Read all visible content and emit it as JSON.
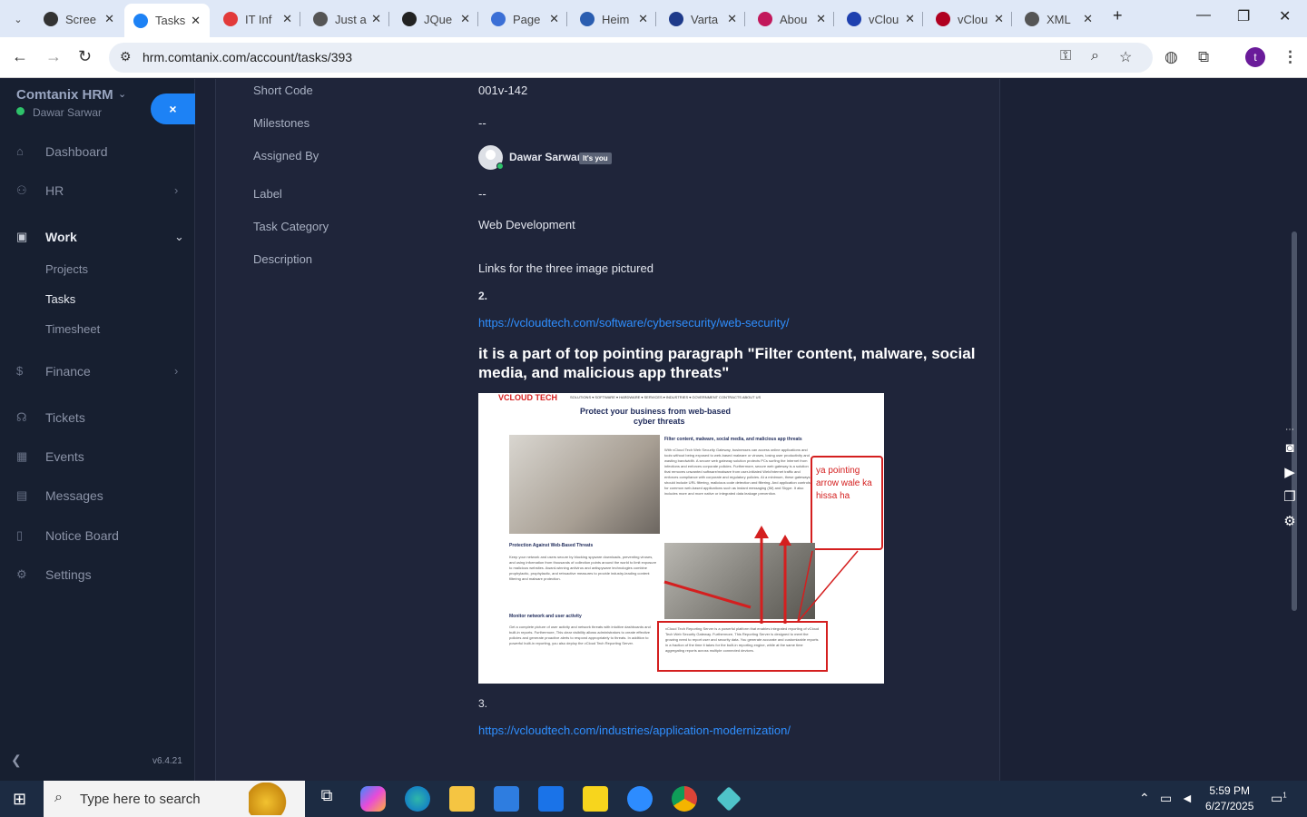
{
  "browser": {
    "tabs": [
      {
        "title": "Scree",
        "color": "#333333"
      },
      {
        "title": "Tasks",
        "color": "#1d82f5",
        "active": true
      },
      {
        "title": "IT Inf",
        "color": "#e23a3a"
      },
      {
        "title": "Just a",
        "color": "#555555"
      },
      {
        "title": "JQue",
        "color": "#222222"
      },
      {
        "title": "Page",
        "color": "#3b6fd6"
      },
      {
        "title": "Heim",
        "color": "#2a5db0"
      },
      {
        "title": "Varta",
        "color": "#1e3a8a"
      },
      {
        "title": "Abou",
        "color": "#c2185b"
      },
      {
        "title": "vClou",
        "color": "#1e40af"
      },
      {
        "title": "vClou",
        "color": "#b00020"
      },
      {
        "title": "XML",
        "color": "#555555"
      }
    ],
    "url": "hrm.comtanix.com/account/tasks/393",
    "profile_initial": "t"
  },
  "sidebar": {
    "brand": "Comtanix HRM",
    "user": "Dawar Sarwar",
    "close_label": "×",
    "items": [
      {
        "label": "Dashboard",
        "icon": "home-icon"
      },
      {
        "label": "HR",
        "icon": "users-icon"
      },
      {
        "label": "Work",
        "icon": "briefcase-icon"
      },
      {
        "label": "Finance",
        "icon": "dollar-icon"
      },
      {
        "label": "Tickets",
        "icon": "headset-icon"
      },
      {
        "label": "Events",
        "icon": "calendar-icon"
      },
      {
        "label": "Messages",
        "icon": "message-icon"
      },
      {
        "label": "Notice Board",
        "icon": "clipboard-icon"
      },
      {
        "label": "Settings",
        "icon": "gear-icon"
      }
    ],
    "work_sub": [
      "Projects",
      "Tasks",
      "Timesheet"
    ],
    "version": "v6.4.21"
  },
  "task": {
    "short_code_label": "Short Code",
    "short_code": "001v-142",
    "milestones_label": "Milestones",
    "milestones": "--",
    "assigned_by_label": "Assigned By",
    "assigned_by": "Dawar Sarwar",
    "its_you": "It's you",
    "label_label": "Label",
    "label": "--",
    "category_label": "Task Category",
    "category": "Web Development",
    "description_label": "Description",
    "description": {
      "intro": "Links for the three image pictured",
      "num2": "2.",
      "link2": "https://vcloudtech.com/software/cybersecurity/web-security/",
      "heading": "it is a part of top pointing paragraph \"Filter content, malware, social media, and malicious app threats\"",
      "num3": "3.",
      "link3": "https://vcloudtech.com/industries/application-modernization/"
    }
  },
  "embedded_image": {
    "logo": "VCLOUD TECH",
    "menu": "SOLUTIONS ▾   SOFTWARE ▾   HARDWARE ▾   SERVICES ▾   INDUSTRIES ▾   GOVERNMENT CONTRACTS   ABOUT US",
    "title1": "Protect your business from web-based",
    "title2": "cyber threats",
    "h_filter": "Filter content, malware, social media, and malicious app threats",
    "p_filter": "With vCloud Tech Web Security Gateway, businesses can access online applications and tools without being exposed to web-based malware or viruses, losing user productivity and wasting bandwidth. A secure web gateway solution protects PCs surfing the Internet from infections and enforces corporate policies. Furthermore, secure web gateway is a solution that removes unwanted software/malware from user-initiated Web/Internet traffic and enforces compliance with corporate and regulatory policies. At a minimum, these gateways should include URL filtering, malicious code detection and filtering. And application controls for common web-based applications such as instant messaging (IM) and Skype. It also includes more and more native or integrated data leakage prevention.",
    "h_protect": "Protection Against Web-Based Threats",
    "p_protect": "Keep your network and users secure by blocking spyware downloads, preventing viruses, and using information from thousands of collection points around the world to limit exposure to malicious websites. Award-winning antivirus and antispyware technologies combine prophylactic, prophylactic, and retroactive measures to provide industry-leading content filtering and malware protection.",
    "h_monitor": "Monitor network and user activity",
    "p_monitor": "Get a complete picture of user activity and network threats with intuitive dashboards and built-in reports. Furthermore, This clear visibility allows administrators to create effective policies and generate proactive alerts to respond appropriately to threats. In addition to powerful built-in reporting, you also deploy the vCloud Tech Reporting Server.",
    "p_box": "vCloud Tech Reporting Server is a powerful platform that enables integrated reporting of vCloud Tech Web Security Gateway. Furthermore, This Reporting Server is designed to meet the growing need to report user and security data. You generate accurate and customizable reports in a fraction of the time it takes for the built-in reporting engine, while at the same time aggregating reports across multiple connected devices.",
    "callout": "ya pointing arrow wale ka hissa ha"
  },
  "taskbar": {
    "search_placeholder": "Type here to search",
    "time": "5:59 PM",
    "date": "6/27/2025",
    "notif_count": "1"
  }
}
